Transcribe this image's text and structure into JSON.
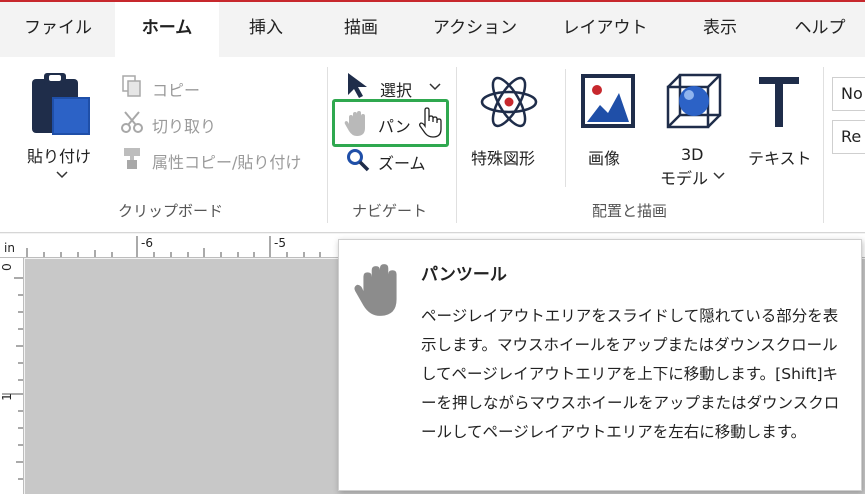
{
  "tabs": [
    {
      "label": "ファイル"
    },
    {
      "label": "ホーム"
    },
    {
      "label": "挿入"
    },
    {
      "label": "描画"
    },
    {
      "label": "アクション"
    },
    {
      "label": "レイアウト"
    },
    {
      "label": "表示"
    },
    {
      "label": "ヘルプ"
    }
  ],
  "active_tab": "ホーム",
  "clipboard": {
    "group_label": "クリップボード",
    "paste_label": "貼り付け",
    "copy_label": "コピー",
    "cut_label": "切り取り",
    "format_copy_label": "属性コピー/貼り付け"
  },
  "navigate": {
    "group_label": "ナビゲート",
    "select_label": "選択",
    "pan_label": "パン",
    "zoom_label": "ズーム"
  },
  "placement": {
    "group_label": "配置と描画",
    "special_shape_label": "特殊図形",
    "image_label": "画像",
    "model3d_label_1": "3D",
    "model3d_label_2": "モデル",
    "text_label": "テキスト"
  },
  "combos": {
    "font_value": "No",
    "style_value": "Re"
  },
  "ruler": {
    "unit": "in",
    "h_labels": [
      "-6",
      "-5"
    ],
    "v_labels": [
      "0",
      "1"
    ]
  },
  "tooltip": {
    "title": "パンツール",
    "description": "ページレイアウトエリアをスライドして隠れている部分を表示します。マウスホイールをアップまたはダウンスクロールしてページレイアウトエリアを上下に移動します。[Shift]キーを押しながらマウスホイールをアップまたはダウンスクロールしてページレイアウトエリアを左右に移動します。"
  },
  "colors": {
    "accent": "#c7282d",
    "highlight": "#2fa84f",
    "icon_dark": "#1f2d4a",
    "icon_blue": "#1f4fa8"
  }
}
